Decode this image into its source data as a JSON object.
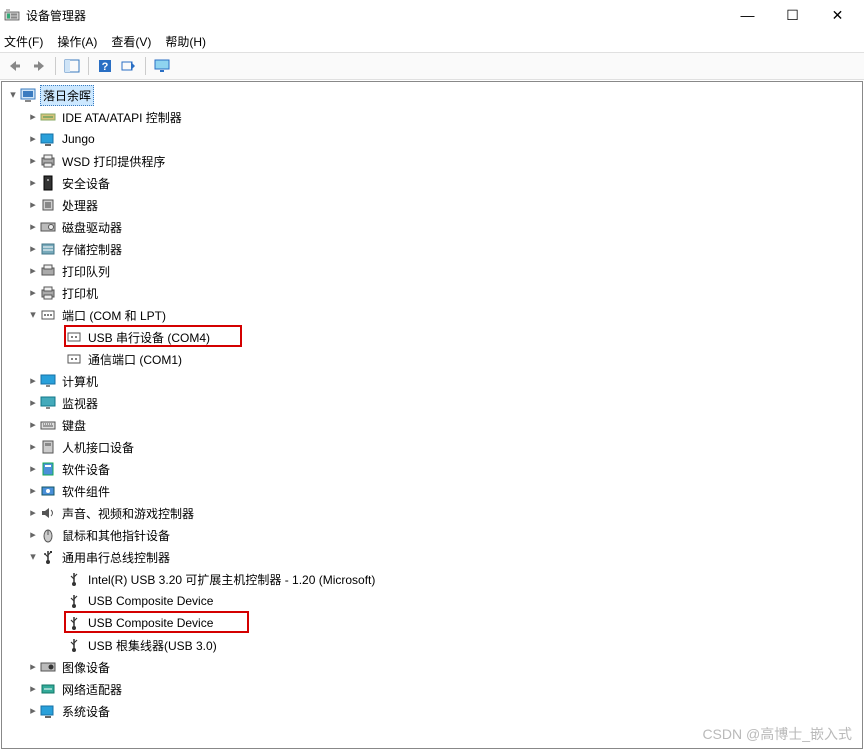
{
  "window": {
    "title": "设备管理器",
    "min": "—",
    "max": "☐",
    "close": "✕"
  },
  "menu": {
    "file": "文件(F)",
    "action": "操作(A)",
    "view": "查看(V)",
    "help": "帮助(H)"
  },
  "root": {
    "label": "落日余晖"
  },
  "cats": {
    "ide": "IDE ATA/ATAPI 控制器",
    "jungo": "Jungo",
    "wsd": "WSD 打印提供程序",
    "security": "安全设备",
    "cpu": "处理器",
    "disk": "磁盘驱动器",
    "storage": "存储控制器",
    "printq": "打印队列",
    "printer": "打印机",
    "ports": "端口 (COM 和 LPT)",
    "computer": "计算机",
    "monitor": "监视器",
    "keyboard": "键盘",
    "hid": "人机接口设备",
    "swdev": "软件设备",
    "swcomp": "软件组件",
    "audio": "声音、视频和游戏控制器",
    "mouse": "鼠标和其他指针设备",
    "usb": "通用串行总线控制器",
    "image": "图像设备",
    "network": "网络适配器",
    "system": "系统设备"
  },
  "ports_children": {
    "usb_serial": "USB 串行设备 (COM4)",
    "comm_port": "通信端口 (COM1)"
  },
  "usb_children": {
    "host": "Intel(R) USB 3.20 可扩展主机控制器 - 1.20 (Microsoft)",
    "comp1": "USB Composite Device",
    "comp2": "USB Composite Device",
    "roothub": "USB 根集线器(USB 3.0)"
  },
  "watermark": "CSDN @高博士_嵌入式"
}
